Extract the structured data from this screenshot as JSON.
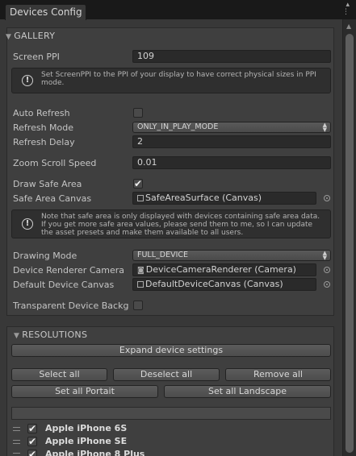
{
  "window": {
    "tab_title": "Devices Config",
    "menu_icon": "⋮",
    "lock_icon": "▴"
  },
  "gallery": {
    "header": "GALLERY",
    "screen_ppi": {
      "label": "Screen PPI",
      "value": "109"
    },
    "ppi_help": "Set ScreenPPI to the PPI of your display to have correct physical sizes in PPI mode.",
    "auto_refresh": {
      "label": "Auto Refresh",
      "checked": false
    },
    "refresh_mode": {
      "label": "Refresh Mode",
      "value": "ONLY_IN_PLAY_MODE"
    },
    "refresh_delay": {
      "label": "Refresh Delay",
      "value": "2"
    },
    "zoom_scroll_speed": {
      "label": "Zoom Scroll Speed",
      "value": "0.01"
    },
    "draw_safe_area": {
      "label": "Draw Safe Area",
      "checked": true,
      "mark": "✔"
    },
    "safe_area_canvas": {
      "label": "Safe Area Canvas",
      "value": "SafeAreaSurface (Canvas)"
    },
    "safe_area_help": "Note that safe area is only displayed with devices containing safe area data. If you get more safe area values, please send them to me, so I can update the asset presets and make them available to all users.",
    "drawing_mode": {
      "label": "Drawing Mode",
      "value": "FULL_DEVICE"
    },
    "device_renderer_camera": {
      "label": "Device Renderer Camera",
      "value": "DeviceCameraRenderer (Camera)"
    },
    "default_device_canvas": {
      "label": "Default Device Canvas",
      "value": "DefaultDeviceCanvas (Canvas)"
    },
    "transparent_device_background": {
      "label": "Transparent Device Backg",
      "checked": false
    }
  },
  "resolutions": {
    "header": "RESOLUTIONS",
    "expand_button": "Expand device settings",
    "select_all": "Select all",
    "deselect_all": "Deselect all",
    "remove_all": "Remove all",
    "set_all_portrait": "Set all Portait",
    "set_all_landscape": "Set all Landscape",
    "devices": [
      {
        "name": "Apple iPhone 6S",
        "checked": true
      },
      {
        "name": "Apple iPhone SE",
        "checked": true
      },
      {
        "name": "Apple iPhone 8 Plus",
        "checked": true
      }
    ]
  },
  "icons": {
    "info": "info-icon",
    "collapse": "triangle-down-icon",
    "picker": "object-picker-icon",
    "check_glyph": "✔"
  }
}
